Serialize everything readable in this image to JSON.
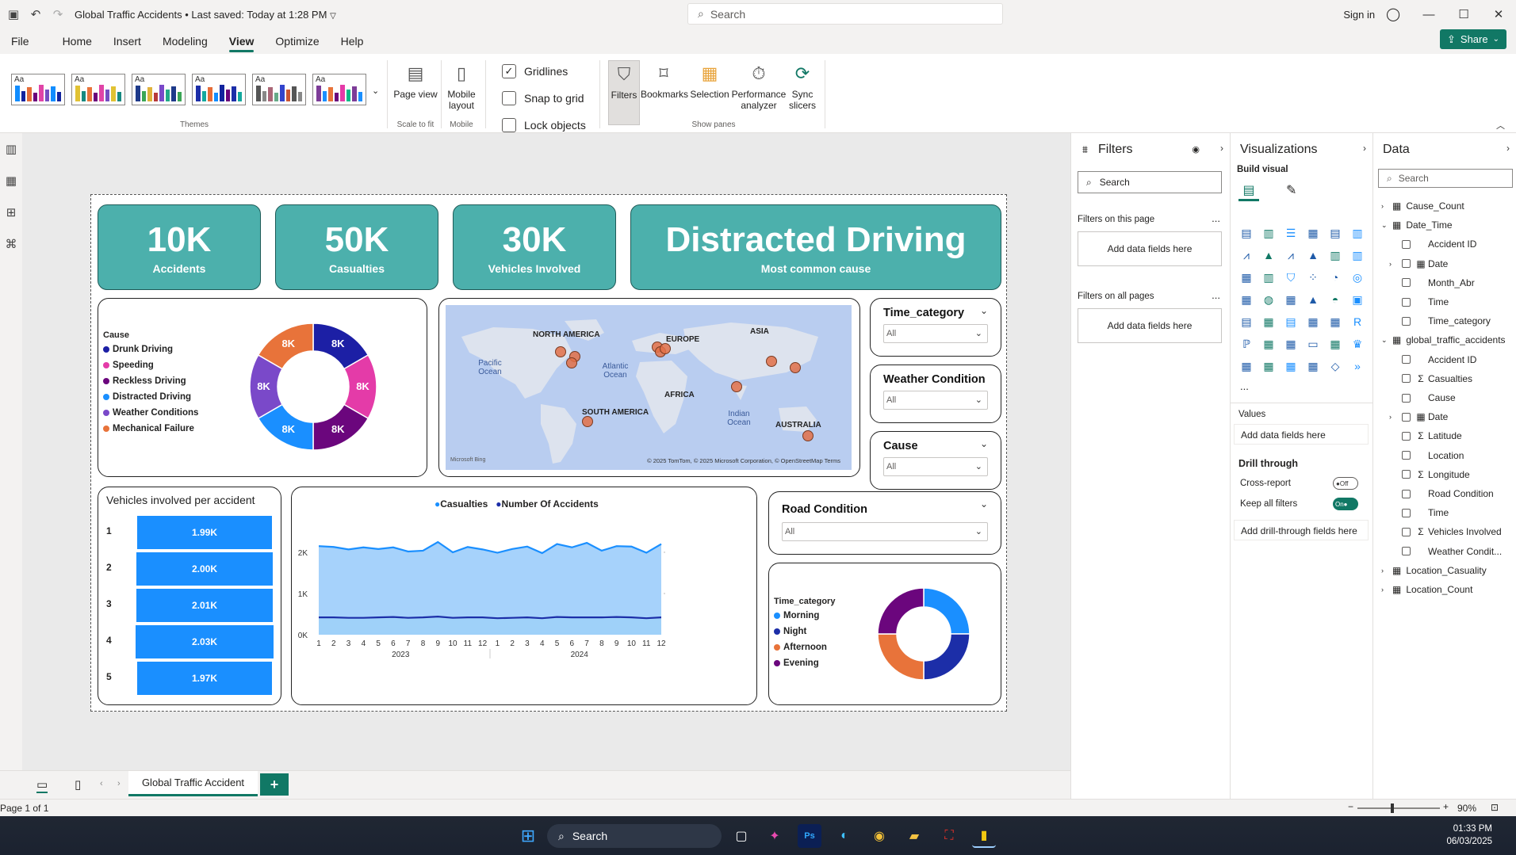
{
  "titlebar": {
    "title": "Global Traffic Accidents",
    "saved": "• Last saved: Today at 1:28 PM",
    "search_placeholder": "Search",
    "signin": "Sign in"
  },
  "menu": {
    "items": [
      "File",
      "Home",
      "Insert",
      "Modeling",
      "View",
      "Optimize",
      "Help"
    ],
    "active": "View",
    "share": "Share"
  },
  "ribbon": {
    "theme_label": "Aa",
    "themes_group": "Themes",
    "page_view": "Page view",
    "scale_group": "Scale to fit",
    "mobile_layout": "Mobile layout",
    "mobile_group": "Mobile",
    "gridlines": "Gridlines",
    "snap": "Snap to grid",
    "lock": "Lock objects",
    "filters": "Filters",
    "bookmarks": "Bookmarks",
    "selection": "Selection",
    "performance": "Performance analyzer",
    "sync": "Sync slicers",
    "show_panes_group": "Show panes"
  },
  "kpis": [
    {
      "value": "10K",
      "label": "Accidents"
    },
    {
      "value": "50K",
      "label": "Casualties"
    },
    {
      "value": "30K",
      "label": "Vehicles Involved"
    },
    {
      "value": "Distracted Driving",
      "label": "Most common cause"
    }
  ],
  "cause_donut": {
    "legend_title": "Cause",
    "items": [
      {
        "name": "Drunk Driving",
        "color": "#1c1fa5",
        "label": "8K"
      },
      {
        "name": "Speeding",
        "color": "#e43ba8",
        "label": "8K"
      },
      {
        "name": "Reckless Driving",
        "color": "#6b067d",
        "label": "8K"
      },
      {
        "name": "Distracted Driving",
        "color": "#1a8fff",
        "label": "8K"
      },
      {
        "name": "Weather Conditions",
        "color": "#7a49c9",
        "label": "8K"
      },
      {
        "name": "Mechanical Failure",
        "color": "#e8733a",
        "label": "8K"
      }
    ]
  },
  "map": {
    "labels": [
      "NORTH AMERICA",
      "EUROPE",
      "ASIA",
      "AFRICA",
      "SOUTH AMERICA",
      "AUSTRALIA"
    ],
    "oceans": [
      "Pacific Ocean",
      "Atlantic Ocean",
      "Indian Ocean"
    ],
    "attribution": "© 2025 TomTom, © 2025 Microsoft Corporation, © OpenStreetMap  Terms",
    "brand": "Microsoft Bing"
  },
  "slicers": [
    {
      "title": "Time_category",
      "value": "All"
    },
    {
      "title": "Weather Condition",
      "value": "All"
    },
    {
      "title": "Cause",
      "value": "All"
    },
    {
      "title": "Road Condition",
      "value": "All"
    }
  ],
  "vehicles_chart": {
    "title": "Vehicles involved per accident",
    "chart_data": {
      "type": "bar",
      "categories": [
        "1",
        "2",
        "3",
        "4",
        "5"
      ],
      "values": [
        1990,
        2000,
        2010,
        2030,
        1970
      ],
      "data_labels": [
        "1.99K",
        "2.00K",
        "2.01K",
        "2.03K",
        "1.97K"
      ]
    }
  },
  "line_chart": {
    "legend": [
      {
        "name": "Casualties",
        "color": "#1a8fff"
      },
      {
        "name": "Number Of Accidents",
        "color": "#1c2ea8"
      }
    ],
    "y_ticks": [
      "2K",
      "1K",
      "0K"
    ],
    "x_months": [
      "1",
      "2",
      "3",
      "4",
      "5",
      "6",
      "7",
      "8",
      "9",
      "10",
      "11",
      "12",
      "1",
      "2",
      "3",
      "4",
      "5",
      "6",
      "7",
      "8",
      "9",
      "10",
      "11",
      "12"
    ],
    "years": [
      "2023",
      "2024"
    ]
  },
  "chart_data": {
    "type": "area",
    "x": [
      "2023-01",
      "2023-02",
      "2023-03",
      "2023-04",
      "2023-05",
      "2023-06",
      "2023-07",
      "2023-08",
      "2023-09",
      "2023-10",
      "2023-11",
      "2023-12",
      "2024-01",
      "2024-02",
      "2024-03",
      "2024-04",
      "2024-05",
      "2024-06",
      "2024-07",
      "2024-08",
      "2024-09",
      "2024-10",
      "2024-11",
      "2024-12"
    ],
    "ylim": [
      0,
      2500
    ],
    "series": [
      {
        "name": "Casualties",
        "values": [
          2150,
          2130,
          2070,
          2120,
          2080,
          2120,
          2020,
          2040,
          2250,
          2000,
          2130,
          2070,
          1990,
          2080,
          2140,
          1980,
          2200,
          2120,
          2230,
          2040,
          2150,
          2140,
          1990,
          2200
        ]
      },
      {
        "name": "Number Of Accidents",
        "values": [
          420,
          420,
          410,
          410,
          420,
          430,
          410,
          420,
          440,
          410,
          420,
          420,
          400,
          410,
          420,
          400,
          430,
          420,
          420,
          420,
          430,
          420,
          400,
          420
        ]
      }
    ]
  },
  "time_donut": {
    "legend_title": "Time_category",
    "items": [
      {
        "name": "Morning",
        "color": "#1a8fff"
      },
      {
        "name": "Night",
        "color": "#1c2ea8"
      },
      {
        "name": "Afternoon",
        "color": "#e8733a"
      },
      {
        "name": "Evening",
        "color": "#6b067d"
      }
    ]
  },
  "filters_pane": {
    "title": "Filters",
    "search": "Search",
    "this_page": "Filters on this page",
    "add": "Add data fields here",
    "all_pages": "Filters on all pages",
    "more": "..."
  },
  "viz_pane": {
    "title": "Visualizations",
    "build": "Build visual",
    "more": "...",
    "values": "Values",
    "add_values": "Add data fields here",
    "drill": "Drill through",
    "cross": "Cross-report",
    "cross_state": "Off",
    "keep": "Keep all filters",
    "keep_state": "On",
    "add_drill": "Add drill-through fields here"
  },
  "data_pane": {
    "title": "Data",
    "search": "Search",
    "rows": [
      {
        "text": "Cause_Count",
        "level": 0,
        "type": "table"
      },
      {
        "text": "Date_Time",
        "level": 0,
        "type": "table",
        "open": true
      },
      {
        "text": "Accident ID",
        "level": 1
      },
      {
        "text": "Date",
        "level": 1,
        "type": "date"
      },
      {
        "text": "Month_Abr",
        "level": 1
      },
      {
        "text": "Time",
        "level": 1
      },
      {
        "text": "Time_category",
        "level": 1
      },
      {
        "text": "global_traffic_accidents",
        "level": 0,
        "type": "table",
        "open": true
      },
      {
        "text": "Accident ID",
        "level": 1
      },
      {
        "text": "Casualties",
        "level": 1,
        "sigma": true
      },
      {
        "text": "Cause",
        "level": 1
      },
      {
        "text": "Date",
        "level": 1,
        "type": "date"
      },
      {
        "text": "Latitude",
        "level": 1,
        "sigma": true
      },
      {
        "text": "Location",
        "level": 1
      },
      {
        "text": "Longitude",
        "level": 1,
        "sigma": true
      },
      {
        "text": "Road Condition",
        "level": 1
      },
      {
        "text": "Time",
        "level": 1
      },
      {
        "text": "Vehicles Involved",
        "level": 1,
        "sigma": true
      },
      {
        "text": "Weather Condit...",
        "level": 1
      },
      {
        "text": "Location_Casuality",
        "level": 0,
        "type": "table"
      },
      {
        "text": "Location_Count",
        "level": 0,
        "type": "table"
      }
    ]
  },
  "pagetabs": {
    "tab": "Global Traffic Accident",
    "add": "+"
  },
  "status": {
    "page": "Page 1 of 1",
    "zoom": "90%"
  },
  "taskbar": {
    "search": "Search",
    "time": "01:33 PM",
    "date": "06/03/2025"
  }
}
